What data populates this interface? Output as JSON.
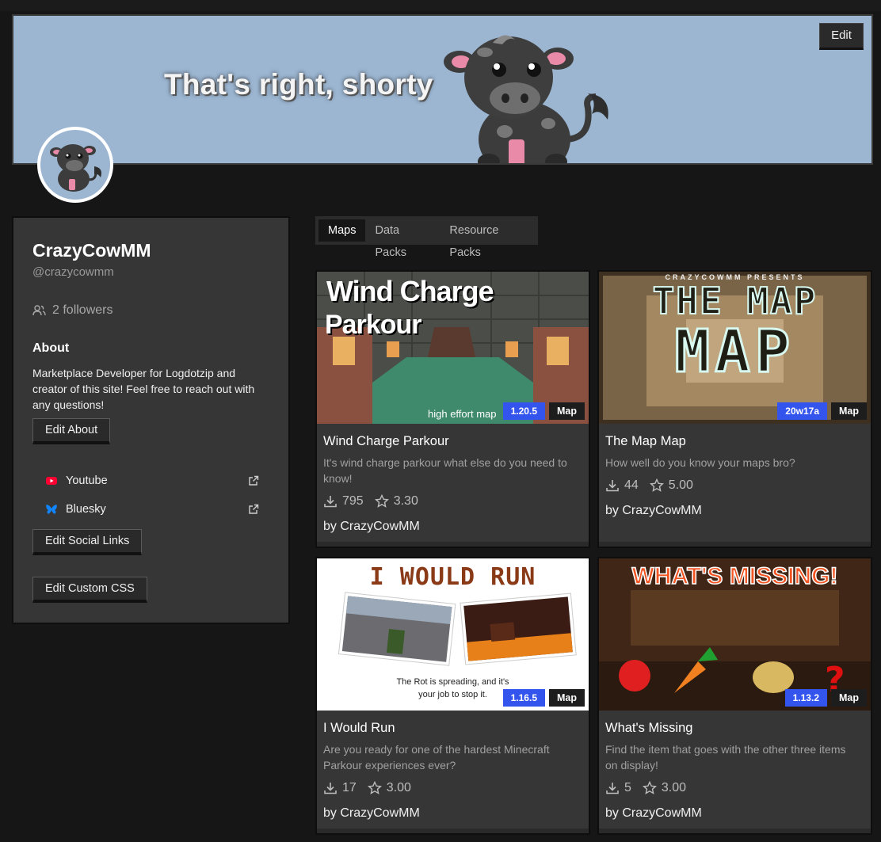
{
  "banner": {
    "text": "That's right, shorty",
    "edit_label": "Edit"
  },
  "profile": {
    "name": "CrazyCowMM",
    "handle": "@crazycowmm",
    "followers": "2 followers",
    "about_heading": "About",
    "about_text": "Marketplace Developer for Logdotzip and creator of this site! Feel free to reach out with any questions!",
    "edit_about_label": "Edit About",
    "socials": [
      {
        "label": "Youtube",
        "icon": "youtube-icon",
        "color": "#ff0033"
      },
      {
        "label": "Bluesky",
        "icon": "bluesky-icon",
        "color": "#1185fe"
      }
    ],
    "edit_social_label": "Edit Social Links",
    "edit_css_label": "Edit Custom CSS"
  },
  "tabs": [
    {
      "label": "Maps",
      "active": true
    },
    {
      "label": "Data Packs",
      "active": false
    },
    {
      "label": "Resource Packs",
      "active": false
    }
  ],
  "cards": [
    {
      "title": "Wind Charge Parkour",
      "desc": "It's wind charge parkour what else do you need to know!",
      "version": "1.20.5",
      "type": "Map",
      "downloads": "795",
      "rating": "3.30",
      "author": "by CrazyCowMM",
      "thumb_text": [
        "Wind Charge",
        "Parkour",
        "high effort map"
      ]
    },
    {
      "title": "The Map Map",
      "desc": "How well do you know your maps bro?",
      "version": "20w17a",
      "type": "Map",
      "downloads": "44",
      "rating": "5.00",
      "author": "by CrazyCowMM",
      "thumb_text": [
        "CRAZYCOWMM PRESENTS",
        "THE MAP",
        "MAP"
      ]
    },
    {
      "title": "I Would Run",
      "desc": "Are you ready for one of the hardest Minecraft Parkour experiences ever?",
      "version": "1.16.5",
      "type": "Map",
      "downloads": "17",
      "rating": "3.00",
      "author": "by CrazyCowMM",
      "thumb_text": [
        "I WOULD RUN",
        "The Rot is spreading, and it's",
        "your job to stop it."
      ]
    },
    {
      "title": "What's Missing",
      "desc": "Find the item that goes with the other three items on display!",
      "version": "1.13.2",
      "type": "Map",
      "downloads": "5",
      "rating": "3.00",
      "author": "by CrazyCowMM",
      "thumb_text": [
        "WHAT'S MISSING!"
      ]
    }
  ]
}
